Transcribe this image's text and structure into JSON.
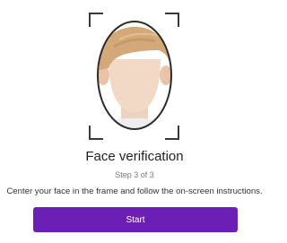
{
  "verification": {
    "title": "Face verification",
    "step": "Step 3 of 3",
    "instructions": "Center your face in the frame and follow the on-screen instructions.",
    "start_label": "Start"
  },
  "icons": {
    "frame": "scan-frame-icon",
    "face": "face-outline-icon"
  },
  "colors": {
    "accent": "#6b1fb4",
    "frame": "#3a3a3a",
    "hair": "#d4a97a",
    "skin": "#f2d9c6"
  }
}
